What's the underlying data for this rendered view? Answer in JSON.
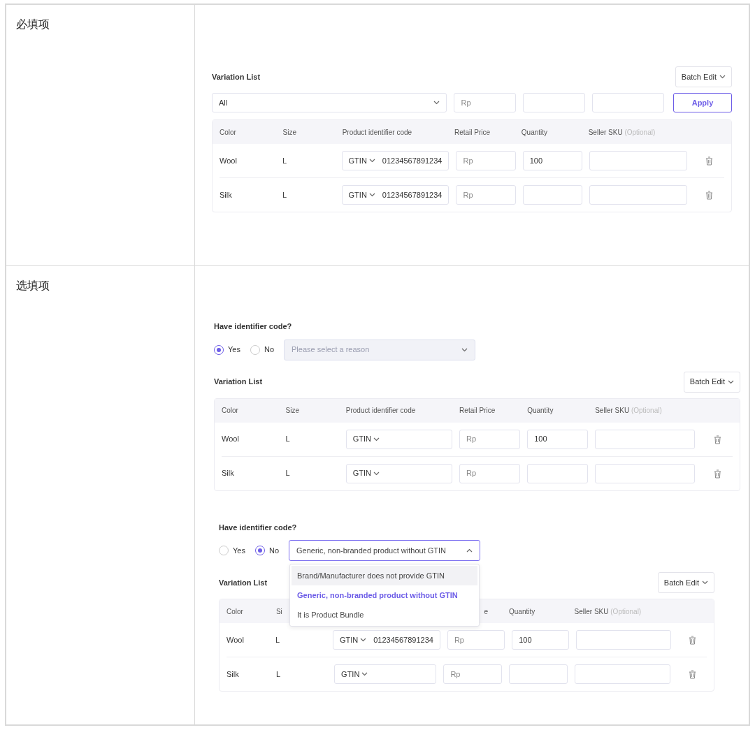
{
  "sections": [
    {
      "label": "必填项",
      "panels": [
        {
          "variation_list": {
            "title": "Variation List",
            "batch_edit": "Batch Edit",
            "batch_row": {
              "select": "All",
              "price_placeholder": "Rp",
              "apply": "Apply"
            },
            "columns": [
              {
                "label": "Color"
              },
              {
                "label": "Size"
              },
              {
                "label": "Product identifier code"
              },
              {
                "label": "Retail Price"
              },
              {
                "label": "Quantity"
              },
              {
                "label": "Seller SKU",
                "note": "(Optional)"
              }
            ],
            "rows": [
              {
                "variant": "Wool",
                "size": "L",
                "code_type": "GTIN",
                "code": "01234567891234",
                "price_placeholder": "Rp",
                "quantity": "100"
              },
              {
                "variant": "Silk",
                "size": "L",
                "code_type": "GTIN",
                "code": "01234567891234",
                "price_placeholder": "Rp"
              }
            ]
          }
        }
      ]
    },
    {
      "label": "选填项",
      "panels": [
        {
          "identifier": {
            "question": "Have identifier code?",
            "options": [
              {
                "label": "Yes",
                "selected": true
              },
              {
                "label": "No",
                "selected": false
              }
            ],
            "reason": {
              "placeholder": "Please select a reason",
              "disabled": true,
              "expanded": false
            }
          },
          "variation_list": {
            "title": "Variation List",
            "batch_edit": "Batch Edit",
            "columns": [
              {
                "label": "Color"
              },
              {
                "label": "Size"
              },
              {
                "label": "Product identifier code"
              },
              {
                "label": "Retail Price"
              },
              {
                "label": "Quantity"
              },
              {
                "label": "Seller SKU",
                "note": "(Optional)"
              }
            ],
            "rows": [
              {
                "variant": "Wool",
                "size": "L",
                "code_type": "GTIN",
                "price_placeholder": "Rp",
                "quantity": "100"
              },
              {
                "variant": "Silk",
                "size": "L",
                "code_type": "GTIN",
                "price_placeholder": "Rp"
              }
            ]
          }
        },
        {
          "identifier": {
            "question": "Have identifier code?",
            "options": [
              {
                "label": "Yes",
                "selected": false
              },
              {
                "label": "No",
                "selected": true
              }
            ],
            "reason": {
              "value": "Generic, non-branded product without GTIN",
              "disabled": false,
              "expanded": true,
              "menu": [
                {
                  "label": "Brand/Manufacturer does not provide GTIN",
                  "hovered": true,
                  "selected": false
                },
                {
                  "label": "Generic, non-branded product without GTIN",
                  "hovered": false,
                  "selected": true
                },
                {
                  "label": "It is Product Bundle",
                  "hovered": false,
                  "selected": false
                }
              ]
            }
          },
          "variation_list": {
            "title": "Variation List",
            "batch_edit": "Batch Edit",
            "columns": [
              {
                "label": "Color"
              },
              {
                "label": "Si"
              },
              {},
              {
                "label": "e"
              },
              {
                "label": "Quantity"
              },
              {
                "label": "Seller SKU",
                "note": "(Optional)"
              }
            ],
            "rows": [
              {
                "variant": "Wool",
                "size": "L",
                "code_type": "GTIN",
                "code": "01234567891234",
                "price_placeholder": "Rp",
                "quantity": "100"
              },
              {
                "variant": "Silk",
                "size": "L",
                "code_type": "GTIN",
                "price_placeholder": "Rp"
              }
            ]
          }
        }
      ]
    }
  ]
}
